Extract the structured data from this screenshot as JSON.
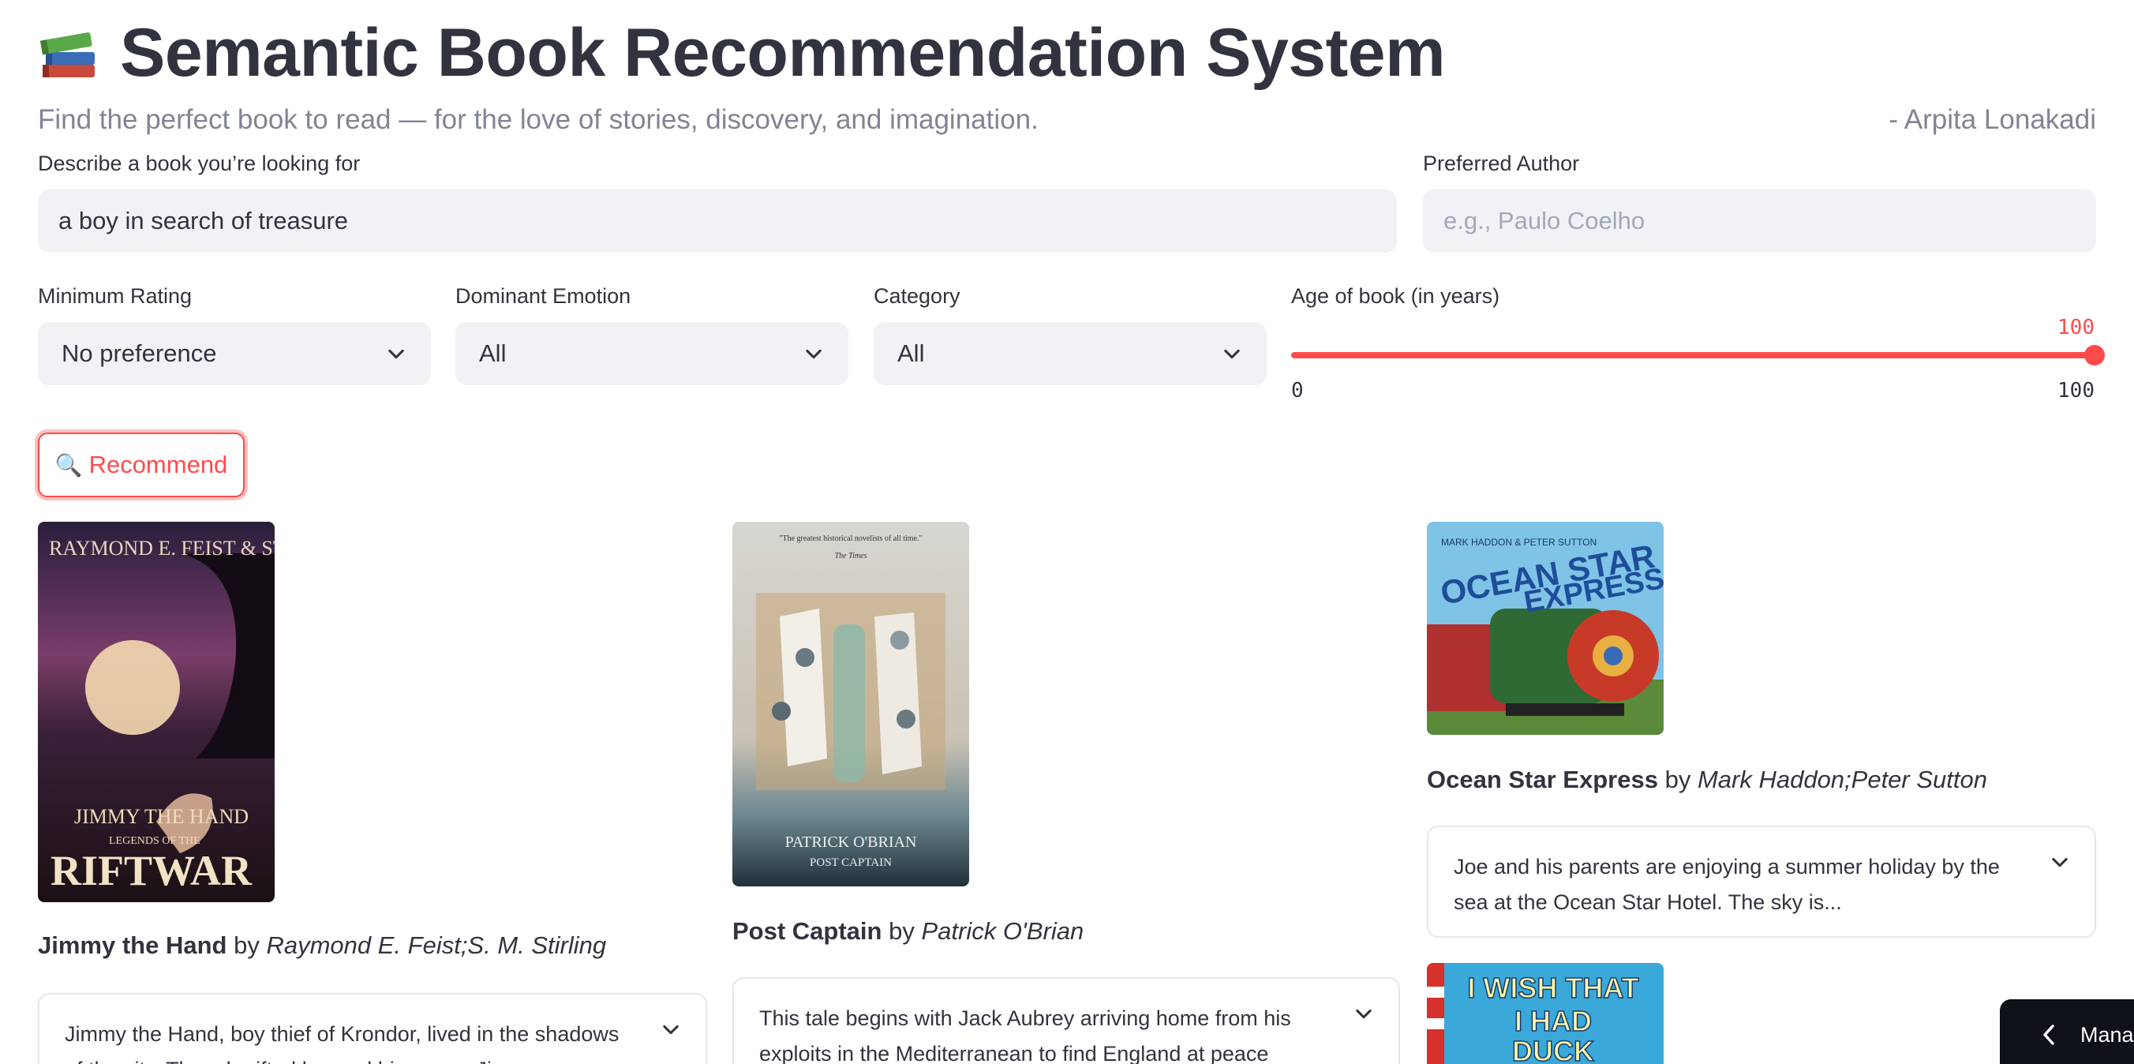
{
  "app": {
    "title": "Semantic Book Recommendation System",
    "subtitle": "Find the perfect book to read — for the love of stories, discovery, and imagination.",
    "author_credit": "- Arpita Lonakadi",
    "title_icon": "books-icon"
  },
  "form": {
    "description_label": "Describe a book you’re looking for",
    "description_value": "a boy in search of treasure",
    "author_label": "Preferred Author",
    "author_placeholder": "e.g., Paulo Coelho",
    "rating_label": "Minimum Rating",
    "rating_value": "No preference",
    "emotion_label": "Dominant Emotion",
    "emotion_value": "All",
    "category_label": "Category",
    "category_value": "All",
    "age_label": "Age of book (in years)",
    "age_value": "100",
    "age_min": "0",
    "age_max": "100",
    "age_fraction": 1.0,
    "recommend_label": "Recommend",
    "recommend_icon": "magnifier-icon"
  },
  "results": [
    {
      "title": "Jimmy the Hand",
      "by": "by",
      "authors": "Raymond E. Feist;S. M. Stirling",
      "description": "Jimmy the Hand, boy thief of Krondor, lived in the shadows of the city. Though gifted beyond his peers, Jimmy...",
      "cover_text": {
        "authors": "RAYMOND E. FEIST & STEVE STIRLING",
        "title": "JIMMY THE HAND",
        "series": "LEGENDS OF THE",
        "series_name": "RIFTWAR"
      }
    },
    {
      "title": "Post Captain",
      "by": "by",
      "authors": "Patrick O'Brian",
      "description": "This tale begins with Jack Aubrey arriving home from his exploits in the Mediterranean to find England at peace",
      "cover_text": {
        "quote": "\"The greatest historical novelists of all time.\"",
        "source": "The Times",
        "author": "PATRICK O'BRIAN",
        "title": "POST CAPTAIN"
      }
    },
    {
      "title": "Ocean Star Express",
      "by": "by",
      "authors": "Mark Haddon;Peter Sutton",
      "description": "Joe and his parents are enjoying a summer holiday by the sea at the Ocean Star Hotel. The sky is...",
      "cover_text": {
        "authors": "MARK HADDON & PETER SUTTON",
        "title_line1": "OCEAN STAR",
        "title_line2": "EXPRESS"
      }
    },
    {
      "cover_text": {
        "line1": "I WISH THAT",
        "line2": "I HAD",
        "line3": "DUCK"
      }
    }
  ],
  "manage": {
    "label": "Manag"
  },
  "colors": {
    "accent": "#ff4b4b",
    "input_bg": "#f0f2f6",
    "text": "#31333f",
    "muted": "#808495"
  }
}
